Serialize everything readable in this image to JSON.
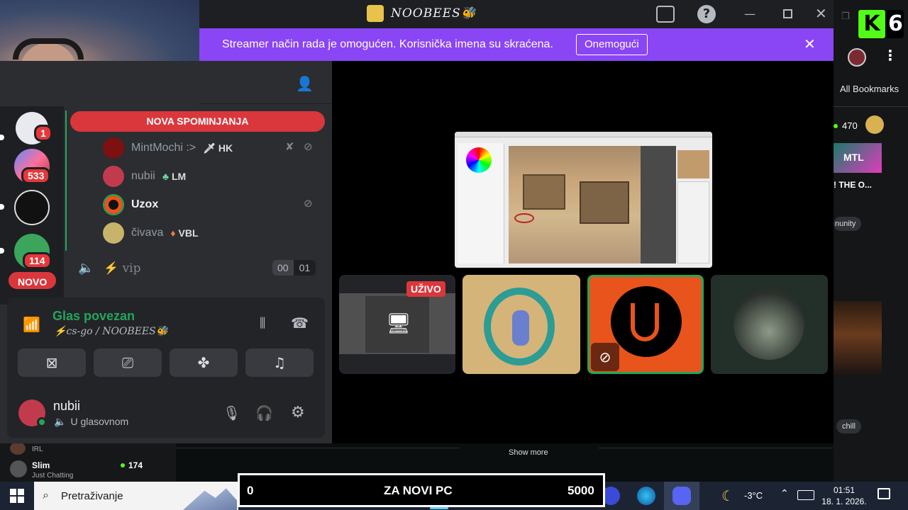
{
  "discord": {
    "server_name": "NOOBEES🐝",
    "banner": {
      "text": "Streamer način rada je omogućen. Korisnička imena su skraćena.",
      "button": "Onemogući"
    },
    "mention_pill": "NOVA SPOMINJANJA",
    "new_pill": "NOVO",
    "servers": [
      {
        "badge": "1"
      },
      {
        "badge": "533"
      },
      {
        "badge": ""
      },
      {
        "badge": "114"
      }
    ],
    "voice_users": [
      {
        "name": "MintMochi :>",
        "tag": "HK",
        "tag_icon": "sword-icon",
        "muted": true
      },
      {
        "name": "nubii",
        "tag": "LM",
        "tag_icon": "leaf-icon",
        "muted": false
      },
      {
        "name": "Uzox",
        "tag": "",
        "tag_icon": "",
        "muted": true
      },
      {
        "name": "čivava",
        "tag": "VBL",
        "tag_icon": "flame-icon",
        "muted": false
      }
    ],
    "channel": {
      "name": "⚡ vip",
      "count_a": "00",
      "count_b": "01"
    },
    "voice_status": {
      "title": "Glas povezan",
      "location": "⚡cs-go / NOOBEES🐝"
    },
    "user": {
      "name": "nubii",
      "status": "U glasovnom"
    },
    "live_badge": "UŽIVO"
  },
  "kick": {
    "bookmarks": "All Bookmarks",
    "viewer_count_top": "470",
    "stream_title": "! THE O...",
    "tag_community": "nunity",
    "tag_chill": "chill",
    "show_more": "Show more",
    "sidebar_items": [
      {
        "name": "",
        "category": "IRL",
        "viewers": ""
      },
      {
        "name": "Slim",
        "category": "Just Chatting",
        "viewers": "174"
      }
    ]
  },
  "overlay": {
    "goal_left": "0",
    "goal_text": "ZA NOVI PC",
    "goal_right": "5000"
  },
  "taskbar": {
    "search_placeholder": "Pretraživanje",
    "temperature": "-3°C",
    "time": "01:51",
    "date": "18. 1. 2026."
  },
  "colors": {
    "discord_banner": "#8a45f5",
    "mention_red": "#da373c",
    "voice_green": "#23a55a",
    "kick_green": "#53fc18"
  }
}
